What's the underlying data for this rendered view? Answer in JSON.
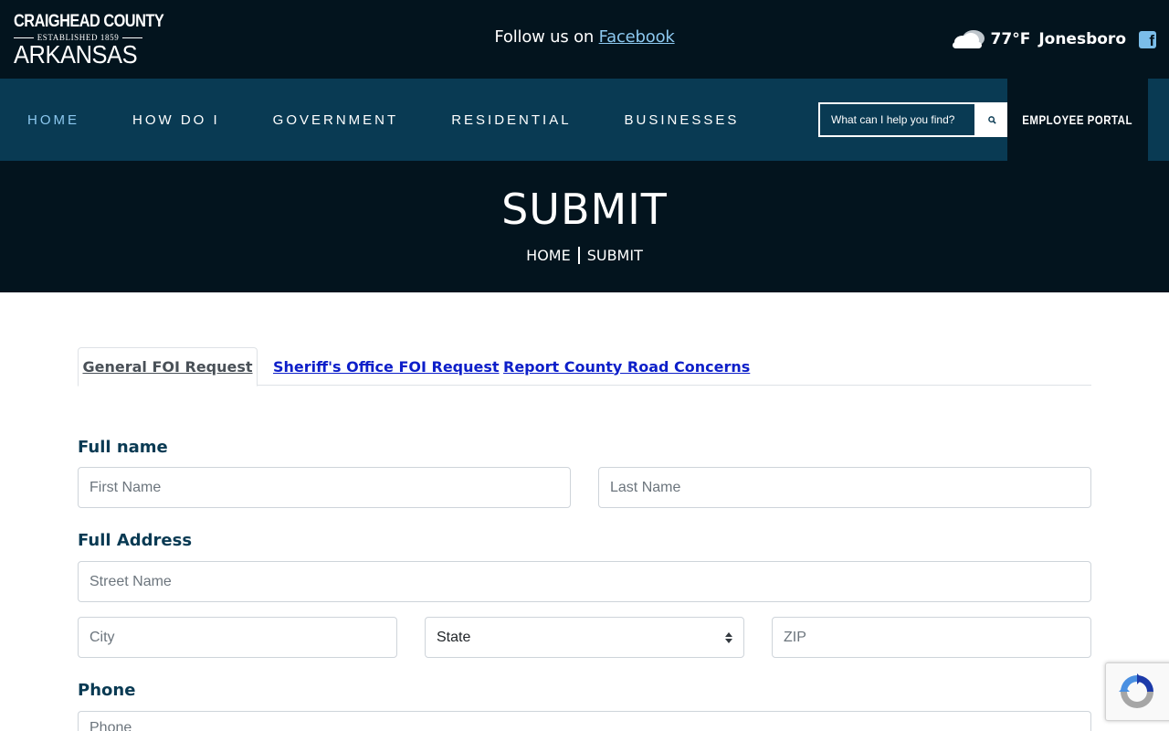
{
  "header": {
    "logo": {
      "line1": "CRAIGHEAD COUNTY",
      "line2": "ESTABLISHED 1859",
      "line3": "ARKANSAS"
    },
    "follow_text": "Follow us on ",
    "follow_link": "Facebook",
    "weather": {
      "temp": "77°F",
      "city": "Jonesboro",
      "icon": "cloud-icon"
    },
    "social_icon": "facebook-icon",
    "social_glyph": "f"
  },
  "nav": {
    "items": [
      {
        "label": "HOME",
        "active": true
      },
      {
        "label": "HOW DO I",
        "active": false
      },
      {
        "label": "GOVERNMENT",
        "active": false
      },
      {
        "label": "RESIDENTIAL",
        "active": false
      },
      {
        "label": "BUSINESSES",
        "active": false
      }
    ],
    "search_placeholder": "What can I help you find?",
    "search_icon": "search-icon",
    "portal_label": "EMPLOYEE PORTAL"
  },
  "hero": {
    "title": "SUBMIT",
    "breadcrumb": [
      "HOME",
      "SUBMIT"
    ]
  },
  "tabs": [
    {
      "label": "General FOI Request",
      "active": true
    },
    {
      "label": "Sheriff's Office FOI Request",
      "active": false
    },
    {
      "label": "Report County Road Concerns",
      "active": false
    }
  ],
  "form": {
    "full_name_label": "Full name",
    "first_name_placeholder": "First Name",
    "last_name_placeholder": "Last Name",
    "address_label": "Full Address",
    "street_placeholder": "Street Name",
    "city_placeholder": "City",
    "state_value": "State",
    "zip_placeholder": "ZIP",
    "phone_label": "Phone",
    "phone_placeholder": "Phone"
  },
  "colors": {
    "topbar": "#03141e",
    "navbar": "#093a53",
    "accent_link": "#8cc8ef",
    "tab_link": "#0d1fc9",
    "label": "#093a53"
  }
}
